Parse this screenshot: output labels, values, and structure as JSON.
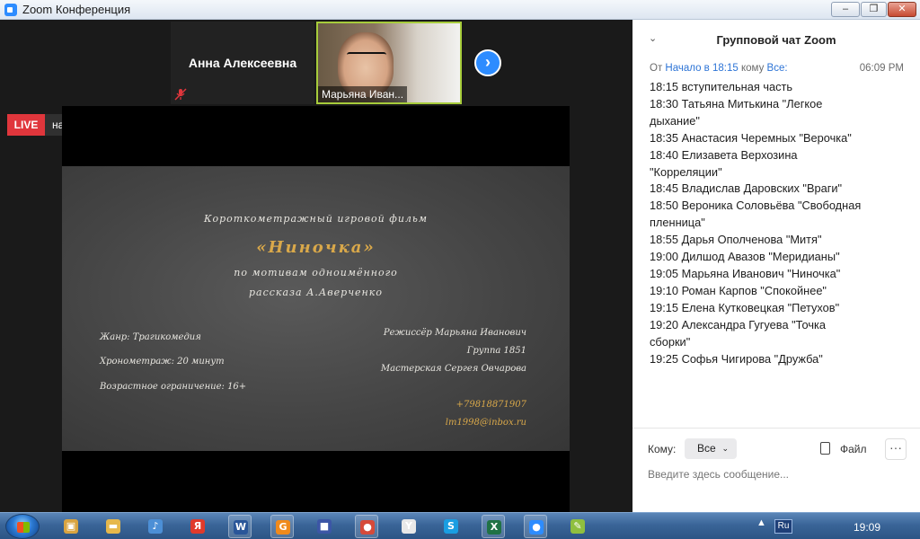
{
  "window": {
    "title": "Zoom Конференция",
    "controls": {
      "minimize": "–",
      "maximize": "❐",
      "close": "✕"
    }
  },
  "participants": {
    "anna": {
      "name": "Анна Алексеевна",
      "mic_state": "muted",
      "mic_icon": "🎤"
    },
    "marina": {
      "label": "Марьяна Иван..."
    },
    "next_arrow": "›"
  },
  "live": {
    "badge": "LIVE",
    "destination": "на YouTube",
    "caret": "▼"
  },
  "poster": {
    "line1": "Короткометражный игровой фильм",
    "title": "«Ниночка»",
    "line3": "по мотивам одноимённого",
    "line4": "рассказа А.Аверченко",
    "genre": "Жанр: Трагикомедия",
    "duration": "Хронометраж: 20 минут",
    "age": "Возрастное ограничение: 16+",
    "director": "Режиссёр Марьяна Иванович",
    "group": "Группа 1851",
    "workshop": "Мастерская Сергея Овчарова",
    "phone": "+79818871907",
    "email": "lm1998@inbox.ru"
  },
  "chat": {
    "title": "Групповой чат Zoom",
    "collapse_icon": "⌄",
    "meta": {
      "from": "От",
      "sender": "Начало в 18:15",
      "to_word": "кому",
      "recipient": "Все:",
      "time": "06:09 PM"
    },
    "message_lines": [
      "18:15 вступительная часть",
      "18:30 Татьяна Митькина \"Легкое",
      "дыхание\"",
      "18:35 Анастасия Черемных \"Верочка\"",
      "18:40 Елизавета Верхозина",
      "\"Корреляции\"",
      "18:45 Владислав Даровских \"Враги\"",
      "18:50 Вероника Соловьёва \"Свободная",
      "пленница\"",
      "18:55 Дарья Ополченова \"Митя\"",
      "19:00 Дилшод Авазов \"Меридианы\"",
      "19:05 Марьяна Иванович \"Ниночка\"",
      "19:10 Роман Карпов \"Спокойнее\"",
      "19:15 Елена Кутковецкая \"Петухов\"",
      "19:20 Александра Гугуева \"Точка",
      "сборки\"",
      "19:25 Софья Чигирова \"Дружба\""
    ],
    "to_label": "Кому:",
    "to_value": "Все",
    "to_caret": "⌄",
    "file_label": "Файл",
    "more": "···",
    "input_placeholder": "Введите здесь сообщение..."
  },
  "taskbar": {
    "apps": [
      {
        "icon": "explorer-icon",
        "glyph": "▣",
        "color": "#d9a441"
      },
      {
        "icon": "folder-icon",
        "glyph": "▬",
        "color": "#e6b84c"
      },
      {
        "icon": "media-player-icon",
        "glyph": "♪",
        "color": "#4c8fd6"
      },
      {
        "icon": "yandex-icon",
        "glyph": "Я",
        "color": "#e03a2b"
      },
      {
        "icon": "word-icon",
        "glyph": "W",
        "color": "#2a5699"
      },
      {
        "icon": "g-app-icon",
        "glyph": "G",
        "color": "#f08a1c"
      },
      {
        "icon": "save-icon",
        "glyph": "■",
        "color": "#3c56a6"
      },
      {
        "icon": "chrome-icon",
        "glyph": "●",
        "color": "#d64a3a"
      },
      {
        "icon": "yandex-browser-icon",
        "glyph": "Y",
        "color": "#e8e8e8"
      },
      {
        "icon": "skype-icon",
        "glyph": "S",
        "color": "#1a9ee2"
      },
      {
        "icon": "excel-icon",
        "glyph": "X",
        "color": "#207245"
      },
      {
        "icon": "zoom-icon",
        "glyph": "●",
        "color": "#2d8cff"
      },
      {
        "icon": "paint-icon",
        "glyph": "✎",
        "color": "#8fbf3f"
      }
    ],
    "tray_arrow": "▲",
    "language": "Ru",
    "clock": "19:09"
  },
  "colors": {
    "zoom_blue": "#2d8cff",
    "live_red": "#e0363c",
    "active_speaker": "#a7cc3b",
    "poster_gold": "#d9a84a"
  }
}
